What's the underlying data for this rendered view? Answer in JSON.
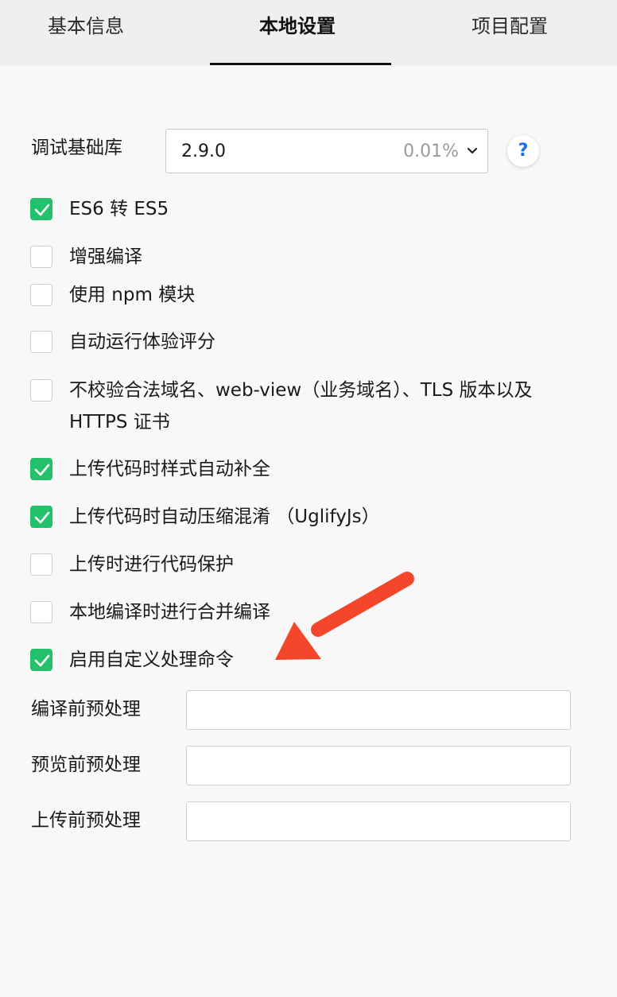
{
  "tabs": [
    {
      "label": "基本信息"
    },
    {
      "label": "本地设置"
    },
    {
      "label": "项目配置"
    }
  ],
  "library": {
    "label": "调试基础库",
    "version": "2.9.0",
    "percent": "0.01%",
    "help": "?"
  },
  "options": [
    {
      "label": "ES6 转 ES5",
      "checked": true
    },
    {
      "label": "增强编译",
      "checked": false
    },
    {
      "label": "使用 npm 模块",
      "checked": false
    },
    {
      "label": "自动运行体验评分",
      "checked": false
    },
    {
      "label": "不校验合法域名、web-view（业务域名）、TLS 版本以及 HTTPS 证书",
      "checked": false
    },
    {
      "label": "上传代码时样式自动补全",
      "checked": true
    },
    {
      "label": "上传代码时自动压缩混淆 （UglifyJs）",
      "checked": true
    },
    {
      "label": "上传时进行代码保护",
      "checked": false
    },
    {
      "label": "本地编译时进行合并编译",
      "checked": false
    },
    {
      "label": "启用自定义处理命令",
      "checked": true
    }
  ],
  "fields": [
    {
      "label": "编译前预处理",
      "value": ""
    },
    {
      "label": "预览前预处理",
      "value": ""
    },
    {
      "label": "上传前预处理",
      "value": ""
    }
  ],
  "colors": {
    "check": "#23c16b",
    "arrow": "#f4462b",
    "help": "#1a6fe0"
  }
}
